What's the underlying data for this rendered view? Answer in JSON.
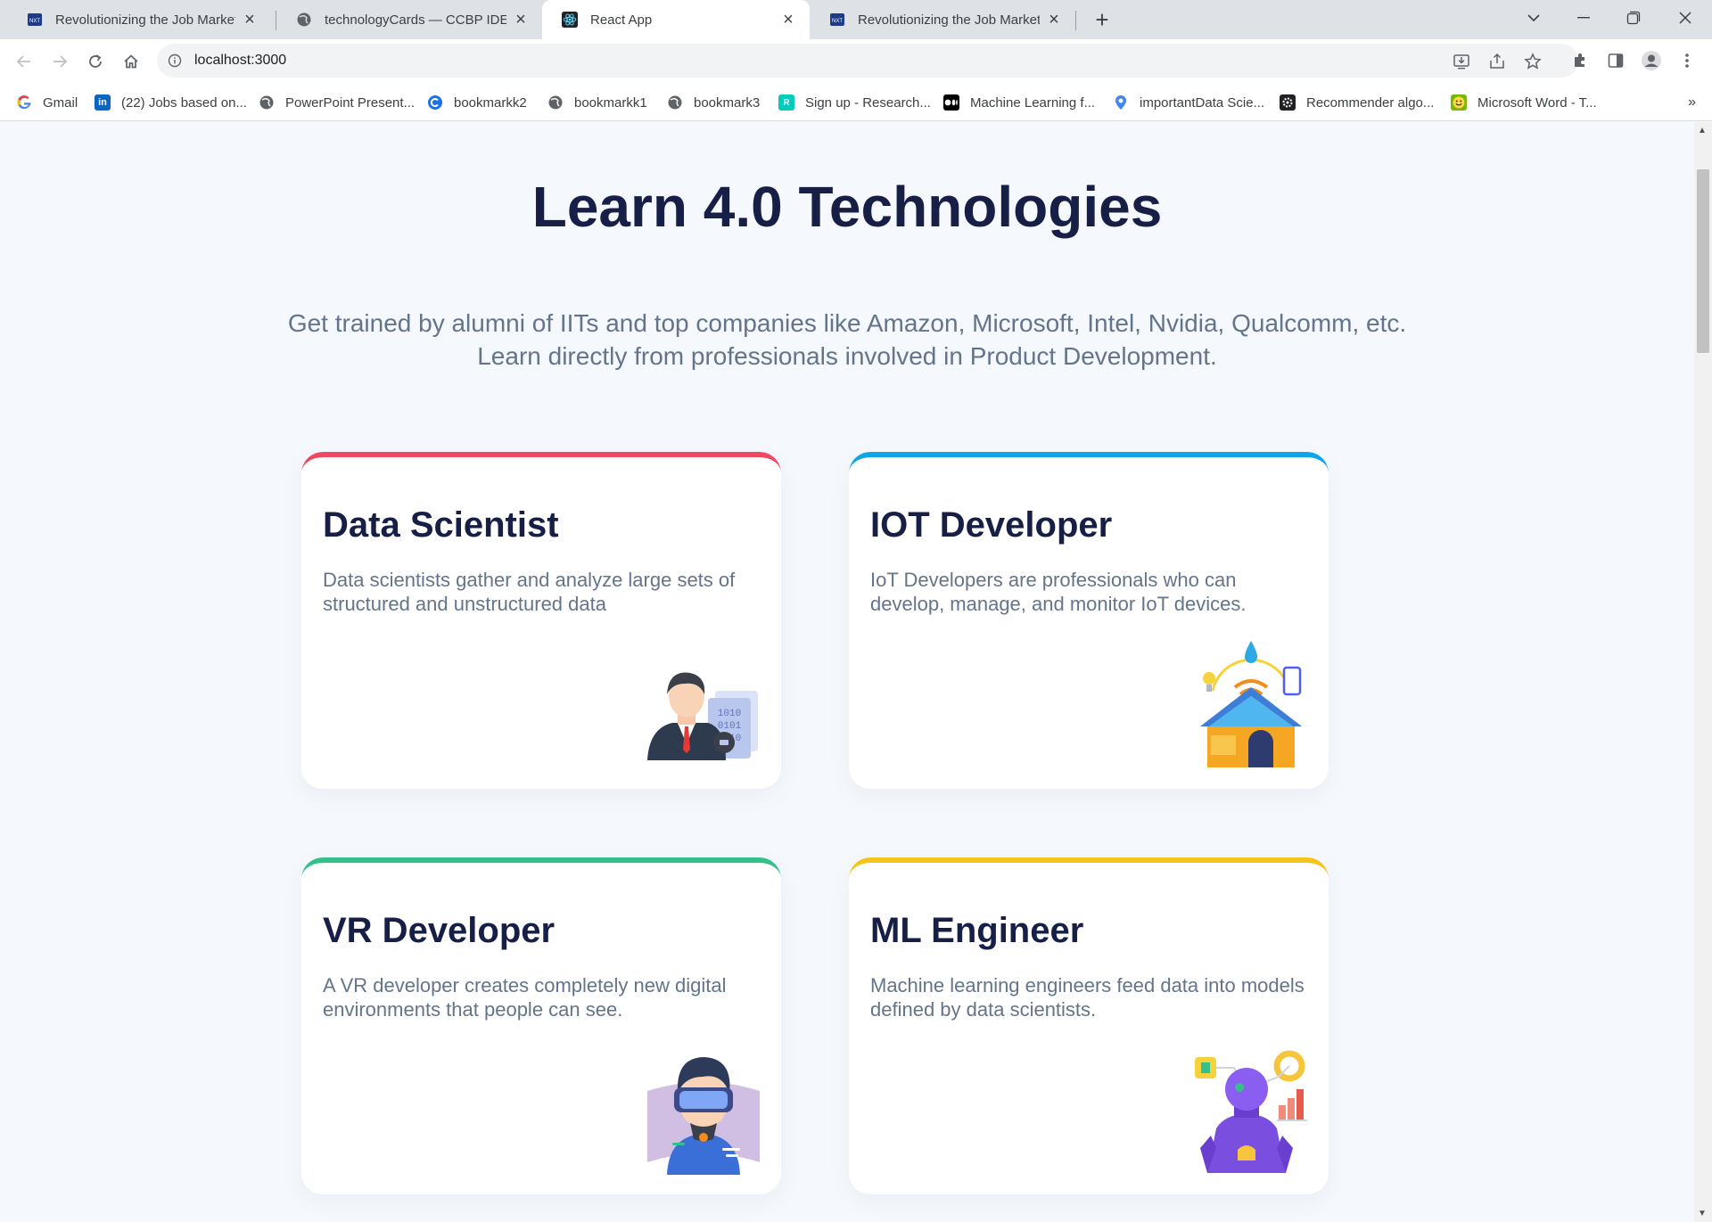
{
  "browser": {
    "tabs": [
      {
        "title": "Revolutionizing the Job Market |",
        "icon": "ccbp-favicon-icon"
      },
      {
        "title": "technologyCards — CCBP IDE",
        "icon": "globe-icon"
      },
      {
        "title": "React App",
        "icon": "react-icon"
      },
      {
        "title": "Revolutionizing the Job Market |",
        "icon": "ccbp-favicon-icon"
      }
    ],
    "url": "localhost:3000",
    "bookmarks": [
      {
        "label": "Gmail",
        "icon": "google-icon"
      },
      {
        "label": "(22) Jobs based on...",
        "icon": "linkedin-icon"
      },
      {
        "label": "PowerPoint Present...",
        "icon": "globe-icon"
      },
      {
        "label": "bookmarkk2",
        "icon": "circle-c-icon"
      },
      {
        "label": "bookmarkk1",
        "icon": "globe-icon"
      },
      {
        "label": "bookmark3",
        "icon": "globe-icon"
      },
      {
        "label": "Sign up - Research...",
        "icon": "researchgate-icon"
      },
      {
        "label": "Machine Learning f...",
        "icon": "medium-icon"
      },
      {
        "label": "importantData Scie...",
        "icon": "map-pin-icon"
      },
      {
        "label": "Recommender algo...",
        "icon": "gear-icon"
      },
      {
        "label": "Microsoft Word - T...",
        "icon": "smiley-icon"
      }
    ],
    "bookmarks_more": "»"
  },
  "page": {
    "heading": "Learn 4.0 Technologies",
    "subheading_line1": "Get trained by alumni of IITs and top companies like Amazon, Microsoft, Intel, Nvidia, Qualcomm, etc.",
    "subheading_line2": "Learn directly from professionals involved in Product Development.",
    "cards": [
      {
        "title": "Data Scientist",
        "description": "Data scientists gather and analyze large sets of structured and unstructured data",
        "accent": "#ef4a62",
        "icon": "data-scientist-illustration"
      },
      {
        "title": "IOT Developer",
        "description": "IoT Developers are professionals who can develop, manage, and monitor IoT devices.",
        "accent": "#0ea5e9",
        "icon": "smart-home-illustration"
      },
      {
        "title": "VR Developer",
        "description": "A VR developer creates completely new digital environments that people can see.",
        "accent": "#34c08a",
        "icon": "vr-headset-illustration"
      },
      {
        "title": "ML Engineer",
        "description": "Machine learning engineers feed data into models defined by data scientists.",
        "accent": "#f5c51b",
        "icon": "robot-illustration"
      }
    ]
  },
  "colors": {
    "heading": "#171f46",
    "body_text": "#64748b",
    "page_bg": "#f5f8fc"
  }
}
